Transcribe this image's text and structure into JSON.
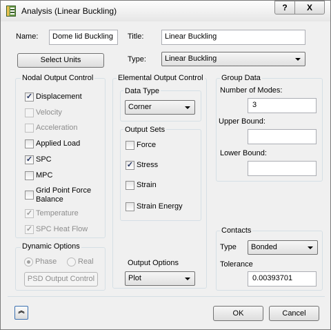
{
  "window": {
    "title": "Analysis (Linear Buckling)",
    "help": "?",
    "close": "X"
  },
  "header": {
    "name_label": "Name:",
    "name_value": "Dome lid Buckling",
    "title_label": "Title:",
    "title_value": "Linear Buckling",
    "select_units": "Select Units",
    "type_label": "Type:",
    "type_value": "Linear Buckling"
  },
  "nodal": {
    "title": "Nodal Output Control",
    "items": [
      {
        "label": "Displacement",
        "checked": true,
        "enabled": true
      },
      {
        "label": "Velocity",
        "checked": false,
        "enabled": false
      },
      {
        "label": "Acceleration",
        "checked": false,
        "enabled": false
      },
      {
        "label": "Applied Load",
        "checked": false,
        "enabled": true
      },
      {
        "label": "SPC",
        "checked": true,
        "enabled": true
      },
      {
        "label": "MPC",
        "checked": false,
        "enabled": true
      },
      {
        "label": "Grid Point Force",
        "label2": "Balance",
        "checked": false,
        "enabled": true
      },
      {
        "label": "Temperature",
        "checked": true,
        "enabled": false
      },
      {
        "label": "SPC Heat Flow",
        "checked": true,
        "enabled": false
      }
    ]
  },
  "elemental": {
    "title": "Elemental Output Control",
    "data_type_title": "Data Type",
    "data_type_value": "Corner",
    "output_sets_title": "Output Sets",
    "sets": [
      {
        "label": "Force",
        "checked": false
      },
      {
        "label": "Stress",
        "checked": true
      },
      {
        "label": "Strain",
        "checked": false
      },
      {
        "label": "Strain Energy",
        "checked": false
      }
    ]
  },
  "group": {
    "title": "Group Data",
    "modes_label": "Number of Modes:",
    "modes_value": "3",
    "upper_label": "Upper Bound:",
    "upper_value": "",
    "lower_label": "Lower Bound:",
    "lower_value": ""
  },
  "dynamic": {
    "title": "Dynamic Options",
    "phase": "Phase",
    "real": "Real",
    "phase_selected": true,
    "psd_button": "PSD Output Control"
  },
  "output_options": {
    "label": "Output Options",
    "value": "Plot"
  },
  "contacts": {
    "title": "Contacts",
    "type_label": "Type",
    "type_value": "Bonded",
    "tolerance_label": "Tolerance",
    "tolerance_value": "0.00393701"
  },
  "footer": {
    "ok": "OK",
    "cancel": "Cancel",
    "expand": "︽"
  }
}
